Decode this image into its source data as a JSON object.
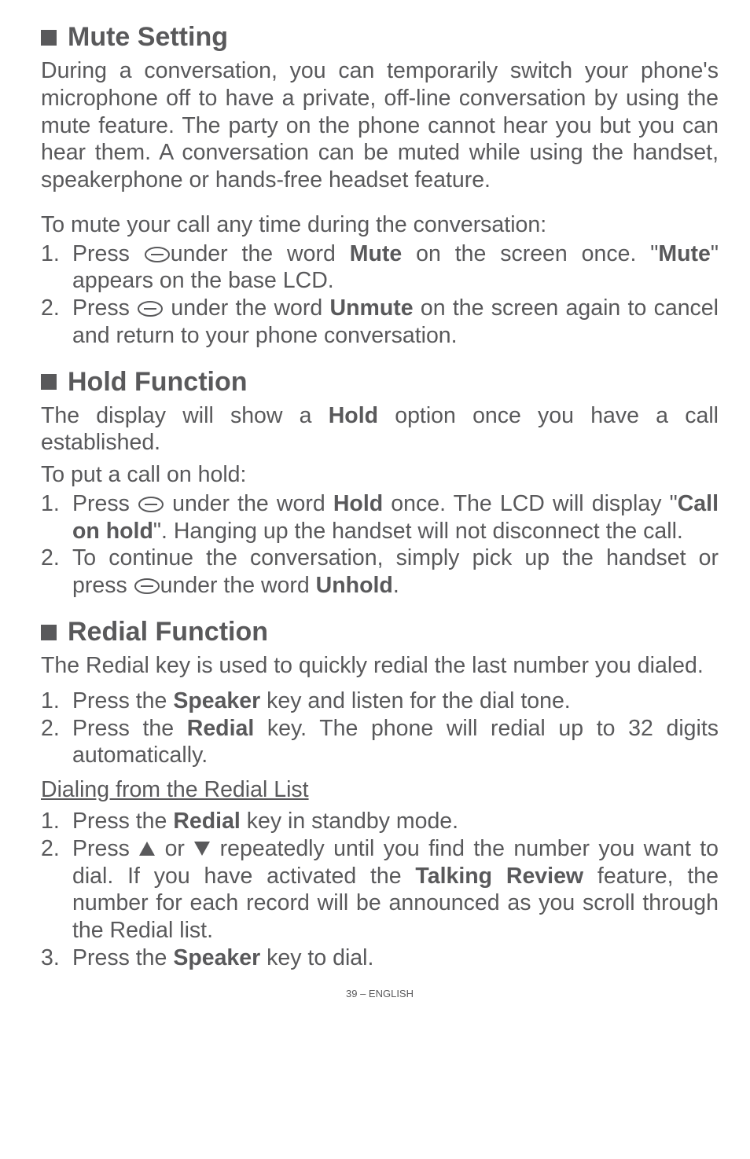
{
  "mute": {
    "heading": "Mute Setting",
    "p1": "During a conversation, you can temporarily switch your phone's microphone off to have a private, off-line conversation by using the mute feature. The party on the phone cannot hear you but you can hear them. A conversation can be muted while using the handset, speakerphone or hands-free headset feature.",
    "lead": "To mute your call any time during the conversation:",
    "s1n": "1.",
    "s1a": "Press ",
    "s1b": "under the word ",
    "s1c": "Mute",
    "s1d": " on the screen once. \"",
    "s1e": "Mute",
    "s1f": "\" appears on the base LCD.",
    "s2n": "2.",
    "s2a": "Press ",
    "s2b": " under the word ",
    "s2c": "Unmute",
    "s2d": " on the screen again to cancel and return to your phone conversation."
  },
  "hold": {
    "heading": "Hold Function",
    "p1a": "The display will show a ",
    "p1b": "Hold",
    "p1c": " option once you have a call established.",
    "lead": "To put a call on hold:",
    "s1n": "1.",
    "s1a": "Press ",
    "s1b": " under the word ",
    "s1c": "Hold",
    "s1d": " once. The LCD will display \"",
    "s1e": "Call on hold",
    "s1f": "\". Hanging up the handset will not disconnect the call.",
    "s2n": "2.",
    "s2a": "To continue the conversation, simply pick up the handset or press ",
    "s2b": "under the word ",
    "s2c": "Unhold",
    "s2d": "."
  },
  "redial": {
    "heading": "Redial Function",
    "p1": "The Redial key is used to quickly redial the last number you dialed.",
    "s1n": "1.",
    "s1a": "Press the ",
    "s1b": "Speaker",
    "s1c": " key and listen for the dial tone.",
    "s2n": "2.",
    "s2a": "Press the ",
    "s2b": "Redial",
    "s2c": " key. The phone will redial up to 32 digits automatically.",
    "sub": "Dialing from the Redial List",
    "d1n": "1.",
    "d1a": "Press the ",
    "d1b": "Redial",
    "d1c": " key in standby mode.",
    "d2n": "2.",
    "d2a": "Press ",
    "d2b": " or ",
    "d2c": " repeatedly until you find the number you want to dial.  If you have activated the ",
    "d2d": "Talking Review",
    "d2e": " feature, the number for each record will be announced as you scroll through the Redial list.",
    "d3n": "3.",
    "d3a": "Press the ",
    "d3b": "Speaker",
    "d3c": " key to dial."
  },
  "footer": "39 – ENGLISH"
}
